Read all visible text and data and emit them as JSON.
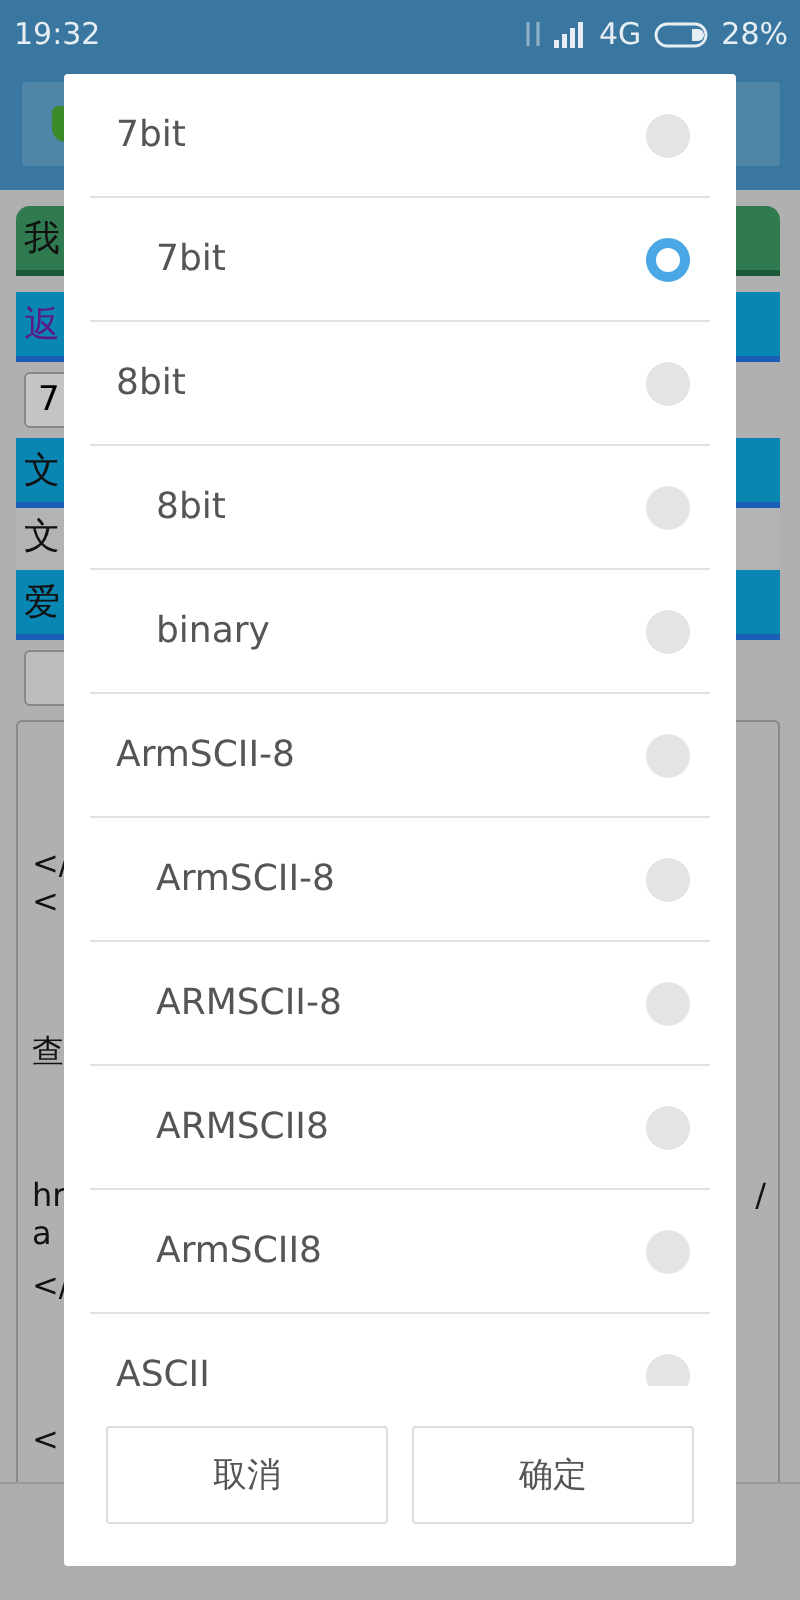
{
  "status_bar": {
    "time": "19:32",
    "network": "4G",
    "battery": "28%"
  },
  "background": {
    "bars": [
      {
        "kind": "green",
        "text": "我"
      },
      {
        "kind": "blue",
        "text": "返"
      },
      {
        "kind": "input",
        "text": "7"
      },
      {
        "kind": "blue",
        "text": "文"
      },
      {
        "kind": "plain",
        "text": "文"
      },
      {
        "kind": "blue",
        "text": "爱"
      },
      {
        "kind": "button"
      }
    ],
    "editor_lines": [
      {
        "text": "</",
        "break_before": true
      },
      {
        "text": "<",
        "break_before": false
      },
      {
        "text": "查",
        "break_before": true
      },
      {
        "text": "hr",
        "tail": "/",
        "break_before": true
      },
      {
        "text": "a",
        "break_before": false
      },
      {
        "text": "</",
        "break_before": false
      },
      {
        "text": "<",
        "break_before": true
      }
    ]
  },
  "dialog": {
    "options": [
      {
        "label": "7bit",
        "selected": false,
        "children": [
          {
            "label": "7bit",
            "selected": true
          }
        ]
      },
      {
        "label": "8bit",
        "selected": false,
        "children": [
          {
            "label": "8bit",
            "selected": false
          },
          {
            "label": "binary",
            "selected": false
          }
        ]
      },
      {
        "label": "ArmSCII-8",
        "selected": false,
        "children": [
          {
            "label": "ArmSCII-8",
            "selected": false
          },
          {
            "label": "ARMSCII-8",
            "selected": false
          },
          {
            "label": "ARMSCII8",
            "selected": false
          },
          {
            "label": "ArmSCII8",
            "selected": false
          }
        ]
      },
      {
        "label": "ASCII",
        "selected": false
      }
    ],
    "buttons": [
      "取消",
      "确定"
    ]
  }
}
